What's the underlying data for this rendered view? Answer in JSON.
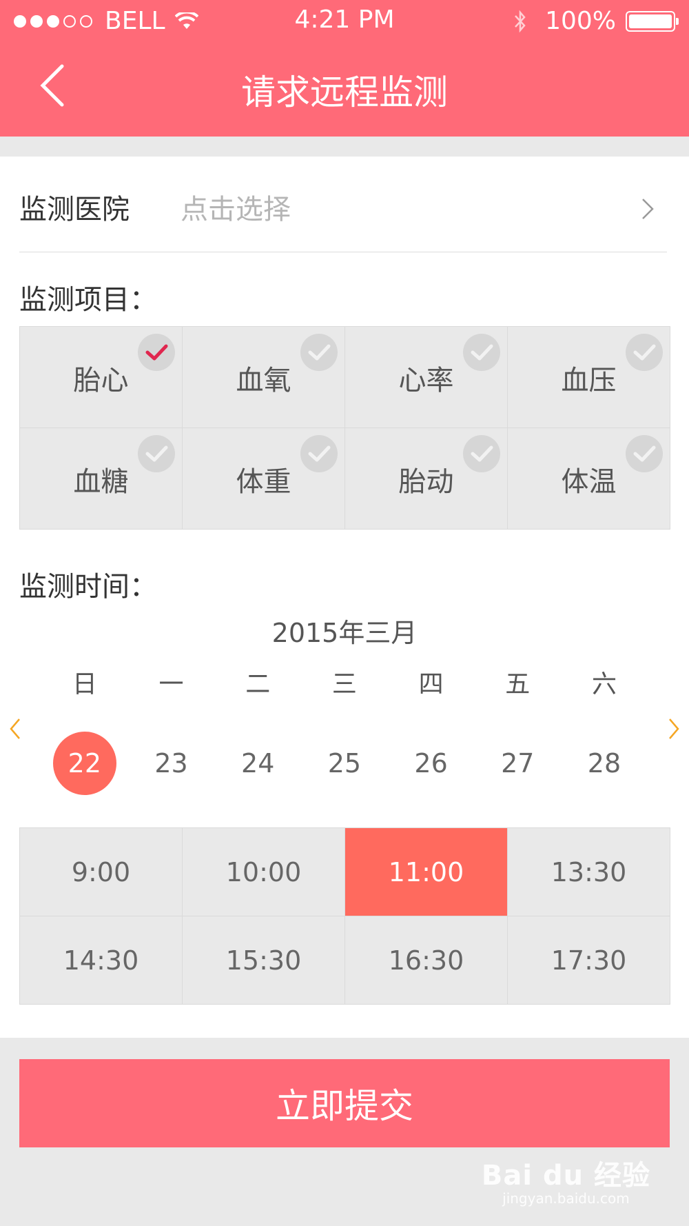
{
  "status_bar": {
    "carrier": "BELL",
    "time": "4:21 PM",
    "battery": "100%",
    "signal_filled": 3,
    "signal_total": 5
  },
  "nav": {
    "title": "请求远程监测",
    "back_icon": "chevron-left-icon"
  },
  "hospital": {
    "label": "监测医院",
    "placeholder": "点击选择"
  },
  "items_section": {
    "label": "监测项目：",
    "items": [
      {
        "label": "胎心",
        "checked": true
      },
      {
        "label": "血氧",
        "checked": false
      },
      {
        "label": "心率",
        "checked": false
      },
      {
        "label": "血压",
        "checked": false
      },
      {
        "label": "血糖",
        "checked": false
      },
      {
        "label": "体重",
        "checked": false
      },
      {
        "label": "胎动",
        "checked": false
      },
      {
        "label": "体温",
        "checked": false
      }
    ]
  },
  "time_section": {
    "label": "监测时间：",
    "month": "2015年三月",
    "weekdays": [
      "日",
      "一",
      "二",
      "三",
      "四",
      "五",
      "六"
    ],
    "days": [
      "22",
      "23",
      "24",
      "25",
      "26",
      "27",
      "28"
    ],
    "selected_day": "22",
    "times": [
      "9:00",
      "10:00",
      "11:00",
      "13:30",
      "14:30",
      "15:30",
      "16:30",
      "17:30"
    ],
    "selected_time": "11:00"
  },
  "submit_label": "立即提交",
  "watermark": {
    "brand": "Bai du 经验",
    "url": "jingyan.baidu.com"
  },
  "colors": {
    "brand": "#ff6a78",
    "selected": "#ff6a5e",
    "check_active": "#e0264e",
    "arrow": "#f5a623"
  }
}
